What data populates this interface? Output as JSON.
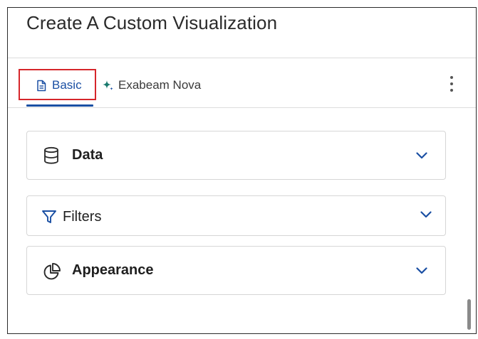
{
  "dialog": {
    "title": "Create A Custom Visualization"
  },
  "tabs": [
    {
      "label": "Basic",
      "icon": "document-icon",
      "active": true,
      "color": "#1a4fa3"
    },
    {
      "label": "Exabeam Nova",
      "icon": "sparkle-icon",
      "active": false,
      "color": "#1a7a6e"
    }
  ],
  "sections": [
    {
      "label": "Data",
      "icon": "database-icon",
      "expanded": false
    },
    {
      "label": "Filters",
      "icon": "filter-icon",
      "expanded": false
    },
    {
      "label": "Appearance",
      "icon": "pie-chart-icon",
      "expanded": false
    }
  ],
  "colors": {
    "accent": "#1a4fa3",
    "highlight_box": "#d6262b"
  }
}
